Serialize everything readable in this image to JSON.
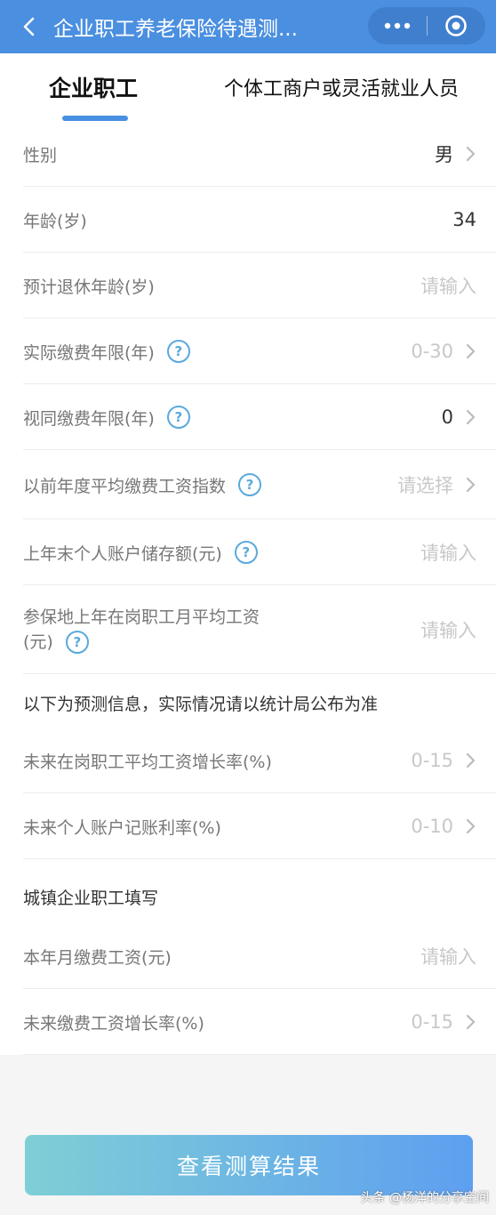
{
  "header": {
    "title": "企业职工养老保险待遇测...",
    "back_icon": "chevron-left-icon",
    "more_icon": "more-dots-icon",
    "close_icon": "target-circle-icon"
  },
  "tabs": [
    {
      "label": "企业职工",
      "active": true
    },
    {
      "label": "个体工商户或灵活就业人员",
      "active": false
    }
  ],
  "rows": [
    {
      "label": "性别",
      "value": "男",
      "placeholder": "",
      "help": false,
      "chevron": true
    },
    {
      "label": "年龄(岁)",
      "value": "34",
      "placeholder": "",
      "help": false,
      "chevron": false
    },
    {
      "label": "预计退休年龄(岁)",
      "value": "",
      "placeholder": "请输入",
      "help": false,
      "chevron": false
    },
    {
      "label": "实际缴费年限(年)",
      "value": "",
      "placeholder": "0-30",
      "help": true,
      "chevron": true
    },
    {
      "label": "视同缴费年限(年)",
      "value": "0",
      "placeholder": "",
      "help": true,
      "chevron": true
    },
    {
      "label": "以前年度平均缴费工资指数",
      "value": "",
      "placeholder": "请选择",
      "help": true,
      "chevron": true
    },
    {
      "label": "上年末个人账户储存额(元)",
      "value": "",
      "placeholder": "请输入",
      "help": true,
      "chevron": false
    },
    {
      "label_line1": "参保地上年在岗职工月平均工资",
      "label_line2": "(元)",
      "value": "",
      "placeholder": "请输入",
      "help": true,
      "chevron": false
    }
  ],
  "section1": {
    "title": "以下为预测信息，实际情况请以统计局公布为准",
    "rows": [
      {
        "label": "未来在岗职工平均工资增长率(%)",
        "placeholder": "0-15",
        "chevron": true
      },
      {
        "label": "未来个人账户记账利率(%)",
        "placeholder": "0-10",
        "chevron": true
      }
    ]
  },
  "section2": {
    "title": "城镇企业职工填写",
    "rows": [
      {
        "label": "本年月缴费工资(元)",
        "placeholder": "请输入",
        "chevron": false
      },
      {
        "label": "未来缴费工资增长率(%)",
        "placeholder": "0-15",
        "chevron": true
      }
    ]
  },
  "submit_label": "查看测算结果",
  "watermark": "头条 @杨洋的分享空间",
  "colors": {
    "header": "#4a8fe0",
    "accent": "#4a90e2",
    "help": "#5aa9dc"
  }
}
